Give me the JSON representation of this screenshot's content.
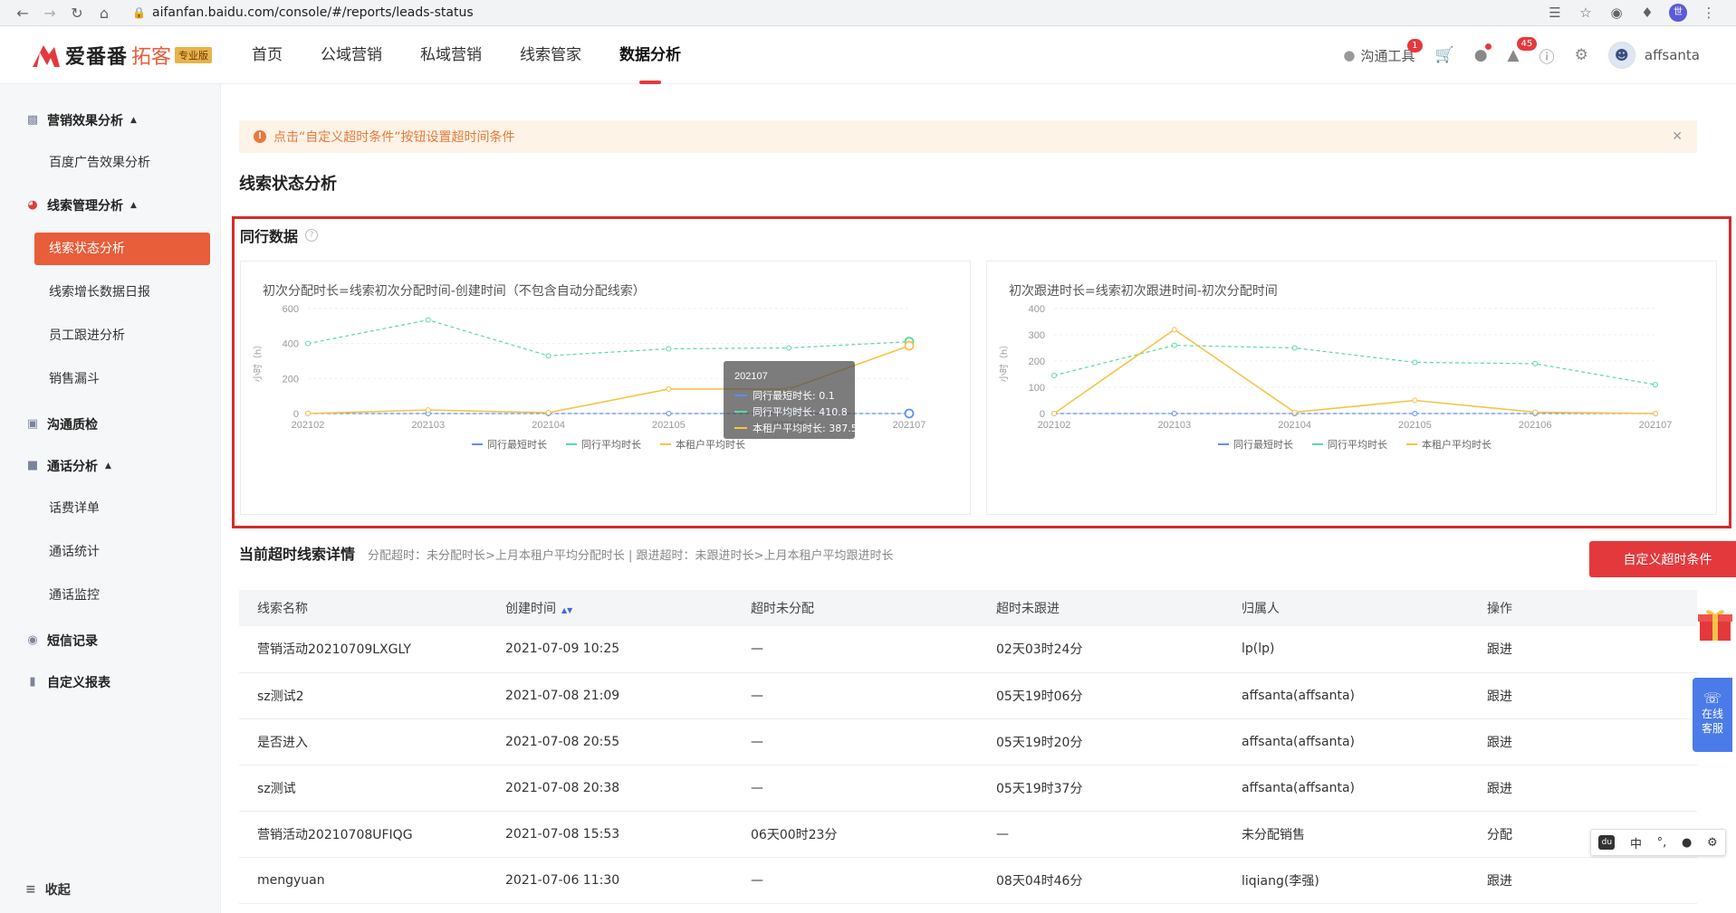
{
  "browser": {
    "url": "aifanfan.baidu.com/console/#/reports/leads-status",
    "profile_initial": "世"
  },
  "header": {
    "logo_name": "爱番番",
    "logo_sub": "拓客",
    "logo_badge": "专业版",
    "nav": [
      "首页",
      "公域营销",
      "私域营销",
      "线索管家",
      "数据分析"
    ],
    "active_nav": "数据分析",
    "tool_label": "沟通工具",
    "tool_badge": "1",
    "bell_badge": "45",
    "user_name": "affsanta"
  },
  "sidebar": {
    "groups": [
      {
        "label": "营销效果分析",
        "items": [
          "百度广告效果分析"
        ]
      },
      {
        "label": "线索管理分析",
        "items": [
          "线索状态分析",
          "线索增长数据日报",
          "员工跟进分析",
          "销售漏斗"
        ]
      },
      {
        "label": "沟通质检",
        "items": []
      },
      {
        "label": "通话分析",
        "items": [
          "话费详单",
          "通话统计",
          "通话监控"
        ]
      },
      {
        "label": "短信记录",
        "items": []
      },
      {
        "label": "自定义报表",
        "items": []
      }
    ],
    "active_item": "线索状态分析",
    "collapse_label": "收起"
  },
  "alert": {
    "text": "点击“自定义超时条件”按钮设置超时间条件"
  },
  "page_title": "线索状态分析",
  "peer": {
    "title": "同行数据"
  },
  "chart_data": [
    {
      "type": "line",
      "title": "初次分配时长=线索初次分配时间-创建时间（不包含自动分配线索）",
      "ylabel": "小时（h）",
      "categories": [
        "202102",
        "202103",
        "202104",
        "202105",
        "202106",
        "202107"
      ],
      "ylim": [
        0,
        600
      ],
      "yticks": [
        0,
        200,
        400,
        600
      ],
      "series": [
        {
          "name": "同行最短时长",
          "color": "#5b8ff9",
          "dashed": true,
          "values": [
            0.1,
            0.1,
            0.1,
            0.1,
            0.1,
            0.1
          ]
        },
        {
          "name": "同行平均时长",
          "color": "#5ad8a6",
          "dashed": true,
          "values": [
            400,
            535,
            330,
            370,
            375,
            410.8
          ]
        },
        {
          "name": "本租户平均时长",
          "color": "#f6c446",
          "dashed": false,
          "values": [
            0,
            20,
            5,
            140,
            140,
            387.5
          ]
        }
      ],
      "tooltip": {
        "category": "202107",
        "lines": [
          "同行最短时长: 0.1",
          "同行平均时长: 410.8",
          "本租户平均时长: 387.5"
        ]
      }
    },
    {
      "type": "line",
      "title": "初次跟进时长=线索初次跟进时间-初次分配时间",
      "ylabel": "小时（h）",
      "categories": [
        "202102",
        "202103",
        "202104",
        "202105",
        "202106",
        "202107"
      ],
      "ylim": [
        0,
        400
      ],
      "yticks": [
        0,
        100,
        200,
        300,
        400
      ],
      "series": [
        {
          "name": "同行最短时长",
          "color": "#5b8ff9",
          "dashed": true,
          "values": [
            0,
            0,
            0,
            0,
            0,
            0
          ]
        },
        {
          "name": "同行平均时长",
          "color": "#5ad8a6",
          "dashed": true,
          "values": [
            145,
            260,
            250,
            195,
            190,
            110
          ]
        },
        {
          "name": "本租户平均时长",
          "color": "#f6c446",
          "dashed": false,
          "values": [
            0,
            320,
            5,
            50,
            5,
            0
          ]
        }
      ]
    }
  ],
  "overdue": {
    "title": "当前超时线索详情",
    "note": "分配超时：未分配时长>上月本租户平均分配时长 | 跟进超时：未跟进时长>上月本租户平均跟进时长",
    "button": "自定义超时条件",
    "columns": [
      "线索名称",
      "创建时间",
      "超时未分配",
      "超时未跟进",
      "归属人",
      "操作"
    ],
    "rows": [
      {
        "name": "营销活动20210709LXGLY",
        "created": "2021-07-09 10:25",
        "unassigned": "—",
        "unfollowed": "02天03时24分",
        "owner": "lp(lp)",
        "op": "跟进"
      },
      {
        "name": "sz测试2",
        "created": "2021-07-08 21:09",
        "unassigned": "—",
        "unfollowed": "05天19时06分",
        "owner": "affsanta(affsanta)",
        "op": "跟进"
      },
      {
        "name": "是否进入",
        "created": "2021-07-08 20:55",
        "unassigned": "—",
        "unfollowed": "05天19时20分",
        "owner": "affsanta(affsanta)",
        "op": "跟进"
      },
      {
        "name": "sz测试",
        "created": "2021-07-08 20:38",
        "unassigned": "—",
        "unfollowed": "05天19时37分",
        "owner": "affsanta(affsanta)",
        "op": "跟进"
      },
      {
        "name": "营销活动20210708UFIQG",
        "created": "2021-07-08 15:53",
        "unassigned": "06天00时23分",
        "unfollowed": "—",
        "owner": "未分配销售",
        "op": "分配"
      },
      {
        "name": "mengyuan",
        "created": "2021-07-06 11:30",
        "unassigned": "—",
        "unfollowed": "08天04时46分",
        "owner": "liqiang(李强)",
        "op": "跟进"
      }
    ]
  },
  "float": {
    "service_line1": "在线",
    "service_line2": "客服"
  },
  "ime": {
    "lang": "中",
    "punct": "°,"
  }
}
